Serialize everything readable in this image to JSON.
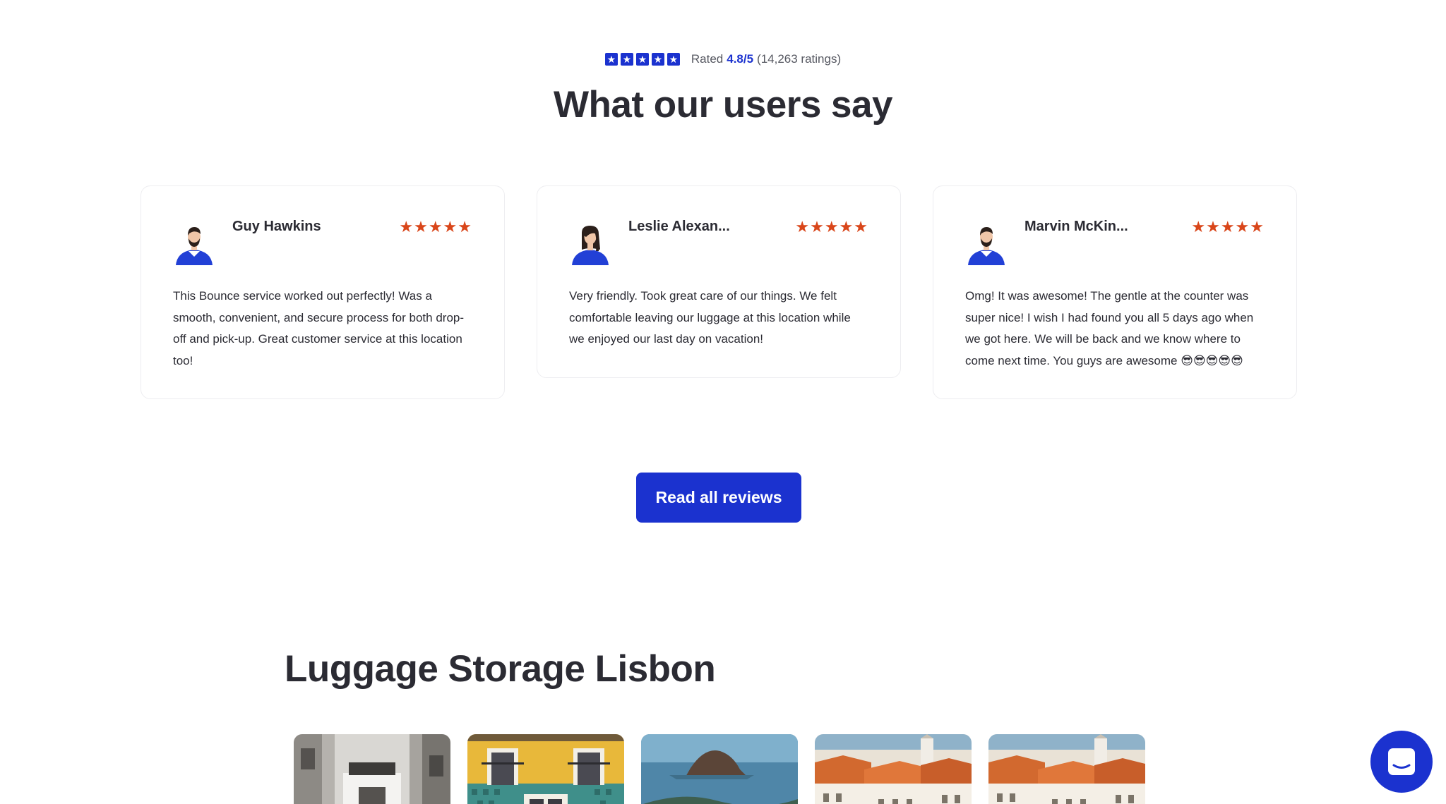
{
  "rating": {
    "prefix": "Rated",
    "score": "4.8/5",
    "count": "(14,263 ratings)",
    "box_star_glyph": "★",
    "box_star_count": 5
  },
  "section_title": "What our users say",
  "reviews": [
    {
      "name": "Guy Hawkins",
      "stars": "★★★★★",
      "avatar": "male-avatar-icon",
      "text": "This Bounce service worked out perfectly! Was a smooth, convenient, and secure process for both drop-off and pick-up. Great customer service at this location too!"
    },
    {
      "name": "Leslie Alexan...",
      "stars": "★★★★★",
      "avatar": "female-avatar-icon",
      "text": "Very friendly. Took great care of our things. We felt comfortable leaving our luggage at this location while we enjoyed our last day on vacation!"
    },
    {
      "name": "Marvin McKin...",
      "stars": "★★★★★",
      "avatar": "male-avatar-icon",
      "text": "Omg! It was awesome! The gentle at the counter was super nice! I wish I had found you all 5 days ago when we got here. We will be back and we know where to come next time. You guys are awesome 😎😎😎😎😎"
    }
  ],
  "read_all_label": "Read all reviews",
  "luggage_title": "Luggage Storage Lisbon",
  "thumbnails": [
    "street-photo",
    "tiled-facade-photo",
    "coastal-rock-photo",
    "city-rooftops-photo",
    "city-rooftops-photo"
  ],
  "colors": {
    "accent": "#1b32cf",
    "review_star": "#d9461a",
    "text": "#2b2b33"
  },
  "chat_icon": "chat-icon"
}
